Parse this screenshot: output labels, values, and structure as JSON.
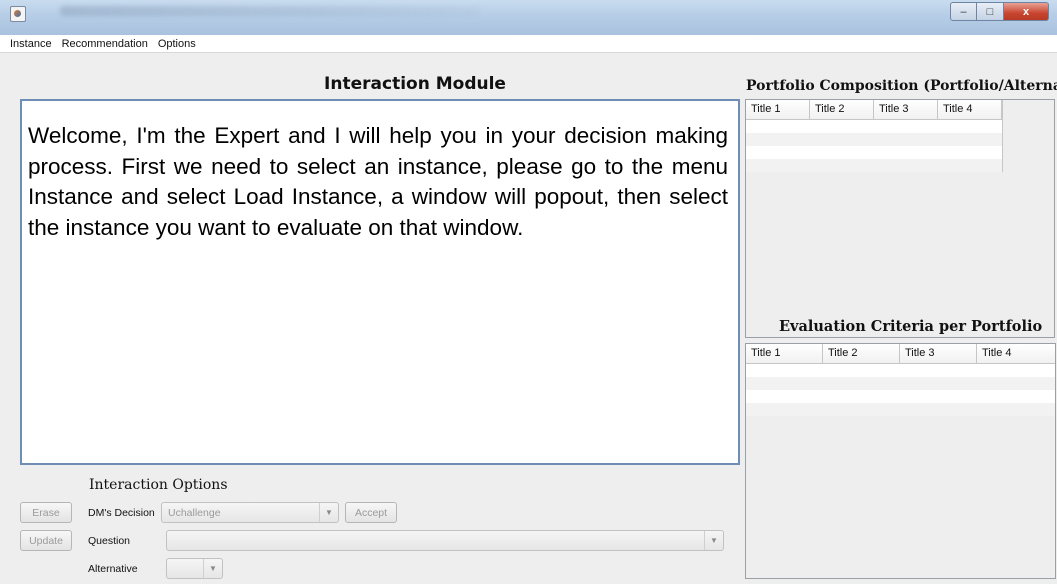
{
  "window": {
    "minimize_glyph": "–",
    "maximize_glyph": "□",
    "close_glyph": "x"
  },
  "menu": [
    "Instance",
    "Recommendation",
    "Options"
  ],
  "interaction_module": {
    "title": "Interaction Module",
    "message": "Welcome, I'm the Expert and I will help you in your decision making process. First we need to select an instance, please go to the menu Instance and select Load Instance, a window will popout, then select the instance you want to evaluate on that window."
  },
  "portfolio_composition": {
    "title": "Portfolio Composition (Portfolio/Alternative)",
    "columns": [
      "Title 1",
      "Title 2",
      "Title 3",
      "Title 4"
    ],
    "rows": [
      [
        "",
        "",
        "",
        ""
      ],
      [
        "",
        "",
        "",
        ""
      ],
      [
        "",
        "",
        "",
        ""
      ],
      [
        "",
        "",
        "",
        ""
      ]
    ]
  },
  "evaluation_criteria": {
    "title": "Evaluation Criteria per Portfolio",
    "columns": [
      "Title 1",
      "Title 2",
      "Title 3",
      "Title 4"
    ],
    "rows": [
      [
        "",
        "",
        "",
        ""
      ],
      [
        "",
        "",
        "",
        ""
      ],
      [
        "",
        "",
        "",
        ""
      ],
      [
        "",
        "",
        "",
        ""
      ]
    ]
  },
  "interaction_options": {
    "label": "Interaction Options",
    "erase_button": "Erase",
    "update_button": "Update",
    "accept_button": "Accept",
    "dm_decision_label": "DM's Decision",
    "dm_decision_value": "Uchallenge",
    "question_label": "Question",
    "question_value": "",
    "alternative_label": "Alternative",
    "alternative_value": "",
    "dropdown_arrow": "▼"
  }
}
